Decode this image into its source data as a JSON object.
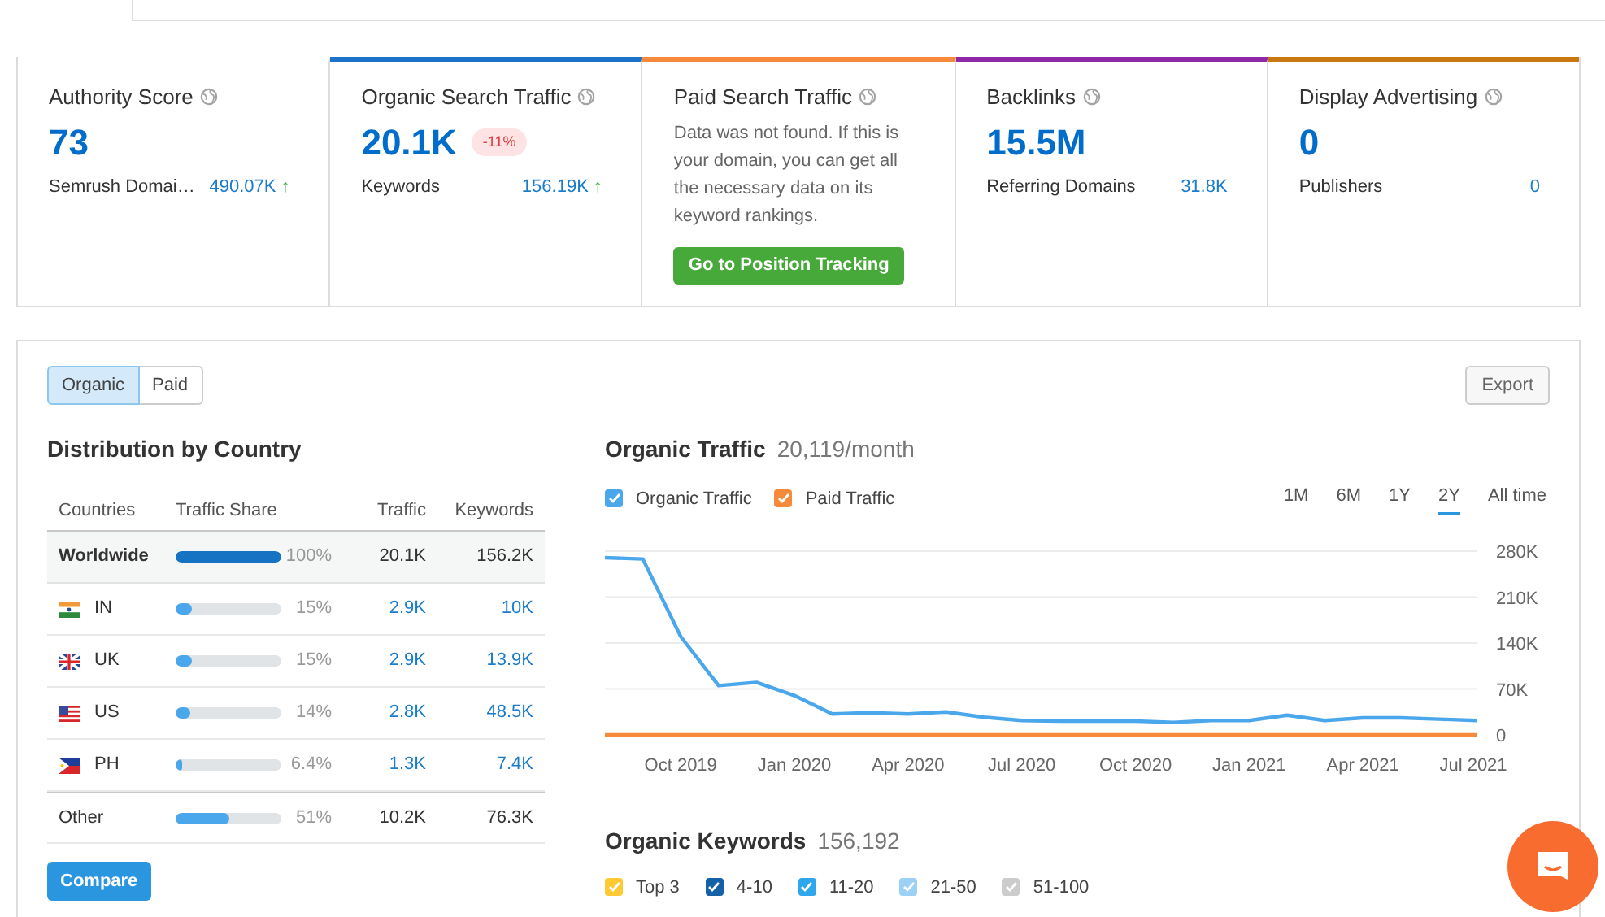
{
  "cards": [
    {
      "kind": "metric",
      "title": "Authority Score",
      "value": "73",
      "sub_label": "Semrush Domai…",
      "sub_value": "490.07K",
      "trend": "↑",
      "color": "#ffffff"
    },
    {
      "kind": "metric",
      "title": "Organic Search Traffic",
      "value": "20.1K",
      "badge": "-11%",
      "sub_label": "Keywords",
      "sub_value": "156.19K",
      "trend": "↑",
      "color": "#1a73c9"
    },
    {
      "kind": "message",
      "title": "Paid Search Traffic",
      "message": "Data was not found. If this is your domain, you can get all the necessary data on its keyword rankings.",
      "button": "Go to Position Tracking",
      "color": "#f7893b"
    },
    {
      "kind": "metric",
      "title": "Backlinks",
      "value": "15.5M",
      "sub_label": "Referring Domains",
      "sub_value": "31.8K",
      "color": "#8e2aa8"
    },
    {
      "kind": "metric",
      "title": "Display Advertising",
      "value": "0",
      "sub_label": "Publishers",
      "sub_value": "0",
      "color": "#c9780f"
    }
  ],
  "toggle": [
    {
      "label": "Organic",
      "selected": true
    },
    {
      "label": "Paid",
      "selected": false
    }
  ],
  "export_button": "Export",
  "distribution": {
    "title": "Distribution by Country",
    "columns": [
      "Countries",
      "Traffic Share",
      "Traffic",
      "Keywords"
    ],
    "rows": [
      {
        "kind": "total",
        "country": "Worldwide",
        "level": 1,
        "share": "100%",
        "traffic": "20.1K",
        "keywords": "156.2K"
      },
      {
        "kind": "india",
        "country": "IN",
        "level": 0.15,
        "share": "15%",
        "traffic": "2.9K",
        "keywords": "10K"
      },
      {
        "kind": "britain",
        "country": "UK",
        "level": 0.15,
        "share": "15%",
        "traffic": "2.9K",
        "keywords": "13.9K"
      },
      {
        "kind": "america",
        "country": "US",
        "level": 0.14,
        "share": "14%",
        "traffic": "2.8K",
        "keywords": "48.5K"
      },
      {
        "kind": "philippines",
        "country": "PH",
        "level": 0.064,
        "share": "6.4%",
        "traffic": "1.3K",
        "keywords": "7.4K"
      },
      {
        "kind": "other",
        "country": "Other",
        "level": 0.51,
        "share": "51%",
        "traffic": "10.2K",
        "keywords": "76.3K"
      }
    ],
    "compare_button": "Compare"
  },
  "traffic": {
    "title": "Organic Traffic",
    "subtitle": "20,119/month",
    "legend": [
      {
        "checked": true
      },
      {
        "checked": true
      }
    ],
    "ranges": [
      {
        "label": "1M",
        "selected": false
      },
      {
        "label": "6M",
        "selected": false
      },
      {
        "label": "1Y",
        "selected": false
      },
      {
        "label": "2Y",
        "selected": true
      },
      {
        "label": "All time",
        "selected": false
      }
    ],
    "chart_data": {
      "type": "line",
      "categories": [
        null,
        null,
        "Oct 2019",
        null,
        null,
        "Jan 2020",
        null,
        null,
        "Apr 2020",
        null,
        null,
        "Jul 2020",
        null,
        null,
        "Oct 2020",
        null,
        null,
        "Jan 2021",
        null,
        null,
        "Apr 2021",
        null,
        null,
        "Jul 2021"
      ],
      "grid": true,
      "series": [
        {
          "name": "Organic Traffic",
          "color": "#4ba7ec",
          "values": [
            270000,
            268000,
            150000,
            75000,
            80000,
            60000,
            32000,
            34000,
            32000,
            35000,
            27000,
            22000,
            21000,
            21000,
            21000,
            19000,
            22000,
            22000,
            30000,
            22000,
            26000,
            26000,
            24000,
            22000
          ]
        },
        {
          "name": "Paid Traffic",
          "color": "#f7893b",
          "values": [
            0,
            0,
            0,
            0,
            0,
            0,
            0,
            0,
            0,
            0,
            0,
            0,
            0,
            0,
            0,
            0,
            0,
            0,
            0,
            0,
            0,
            0,
            0,
            0
          ]
        }
      ],
      "ylim": [
        0,
        280000
      ],
      "yticks": [
        {
          "value": 0,
          "label": "0"
        },
        {
          "value": 70000,
          "label": "70K"
        },
        {
          "value": 140000,
          "label": "140K"
        },
        {
          "value": 210000,
          "label": "210K"
        },
        {
          "value": 280000,
          "label": "280K"
        }
      ]
    }
  },
  "keywords": {
    "title": "Organic Keywords",
    "count": "156,192",
    "legend": [
      {
        "label": "Top 3",
        "checked": true,
        "color": "#ffc933"
      },
      {
        "label": "4-10",
        "checked": true,
        "color": "#1461a8"
      },
      {
        "label": "11-20",
        "checked": true,
        "color": "#2fa7ed"
      },
      {
        "label": "21-50",
        "checked": true,
        "color": "#9dd0f5"
      },
      {
        "label": "51-100",
        "checked": true,
        "color": "#cccccc"
      }
    ]
  }
}
